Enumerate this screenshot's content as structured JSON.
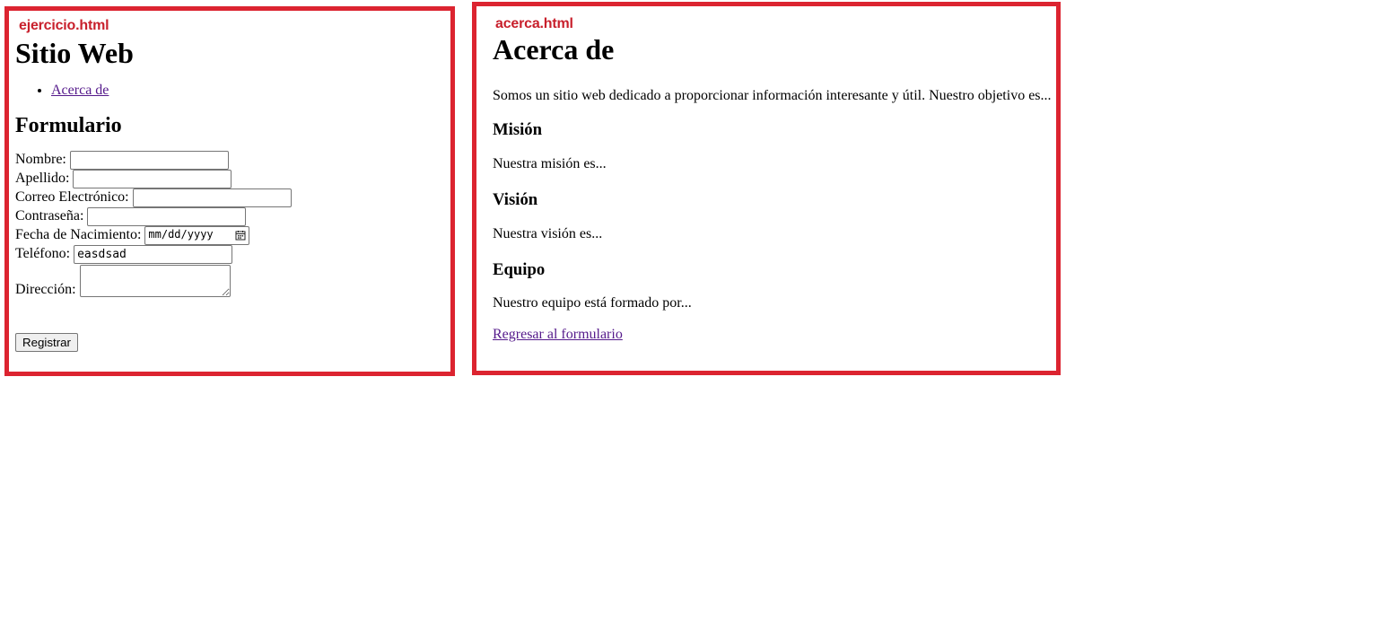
{
  "accent_color": "#dc2430",
  "left": {
    "file_label": "ejercicio.html",
    "title": "Sitio Web",
    "nav": [
      {
        "label": "Acerca de"
      }
    ],
    "form": {
      "heading": "Formulario",
      "nombre_label": "Nombre:",
      "nombre_value": "",
      "apellido_label": "Apellido:",
      "apellido_value": "",
      "correo_label": "Correo Electrónico:",
      "correo_value": "",
      "contrasena_label": "Contraseña:",
      "contrasena_value": "",
      "fecha_label": "Fecha de Nacimiento:",
      "fecha_placeholder": "mm/dd/yyyy",
      "telefono_label": "Teléfono:",
      "telefono_value": "easdsad",
      "direccion_label": "Dirección:",
      "direccion_value": "",
      "submit_label": "Registrar"
    }
  },
  "right": {
    "file_label": "acerca.html",
    "title": "Acerca de",
    "intro": "Somos un sitio web dedicado a proporcionar información interesante y útil. Nuestro objetivo es...",
    "sections": [
      {
        "heading": "Misión",
        "text": "Nuestra misión es..."
      },
      {
        "heading": "Visión",
        "text": "Nuestra visión es..."
      },
      {
        "heading": "Equipo",
        "text": "Nuestro equipo está formado por..."
      }
    ],
    "back_link": "Regresar al formulario"
  }
}
